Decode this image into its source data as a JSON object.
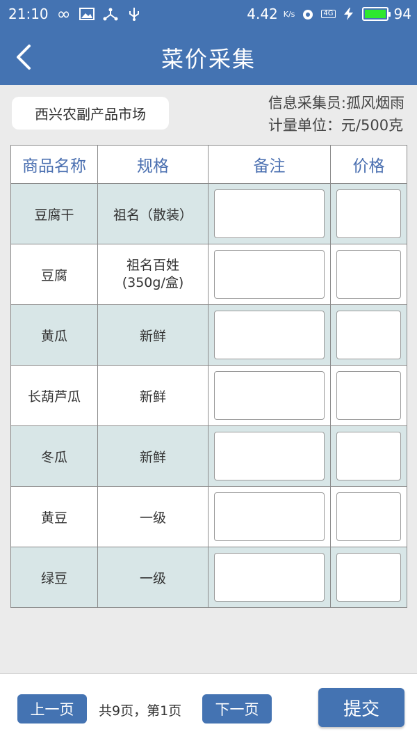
{
  "status_bar": {
    "time": "21:10",
    "speed": "4.42",
    "speed_unit": "K/s",
    "network": "4G",
    "battery": "94",
    "battery_level": 0.94
  },
  "header": {
    "title": "菜价采集"
  },
  "info": {
    "market": "西兴农副产品市场",
    "collector": "信息采集员:孤风烟雨",
    "unit": "计量单位：元/500克"
  },
  "table": {
    "headers": [
      "商品名称",
      "规格",
      "备注",
      "价格"
    ],
    "rows": [
      {
        "name": "豆腐干",
        "spec": [
          "祖名（散装）"
        ]
      },
      {
        "name": "豆腐",
        "spec": [
          "祖名百姓",
          "(350g/盒)"
        ]
      },
      {
        "name": "黄瓜",
        "spec": [
          "新鲜"
        ]
      },
      {
        "name": "长葫芦瓜",
        "spec": [
          "新鲜"
        ]
      },
      {
        "name": "冬瓜",
        "spec": [
          "新鲜"
        ]
      },
      {
        "name": "黄豆",
        "spec": [
          "一级"
        ]
      },
      {
        "name": "绿豆",
        "spec": [
          "一级"
        ]
      }
    ]
  },
  "footer": {
    "prev_label": "上一页",
    "page_info": "共9页，第1页",
    "next_label": "下一页",
    "submit_label": "提交"
  }
}
